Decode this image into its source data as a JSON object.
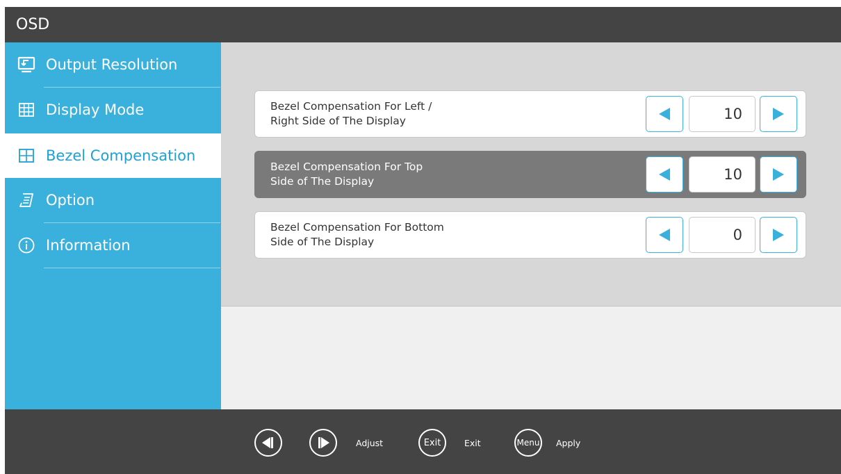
{
  "app": {
    "title": "OSD"
  },
  "sidebar": {
    "items": [
      {
        "label": "Output Resolution",
        "icon": "output-resolution-icon"
      },
      {
        "label": "Display Mode",
        "icon": "grid-icon"
      },
      {
        "label": "Bezel Compensation",
        "icon": "quad-grid-icon",
        "active": true
      },
      {
        "label": "Option",
        "icon": "document-icon"
      },
      {
        "label": "Information",
        "icon": "info-icon"
      }
    ]
  },
  "settings": [
    {
      "line1": "Bezel Compensation For Left /",
      "line2": "Right Side of The Display",
      "value": "10"
    },
    {
      "line1": "Bezel Compensation For Top",
      "line2": "Side of The Display",
      "value": "10",
      "selected": true
    },
    {
      "line1": "Bezel Compensation For Bottom",
      "line2": "Side of The Display",
      "value": "0"
    }
  ],
  "footer": {
    "adjust_label": "Adjust",
    "exit_button": "Exit",
    "exit_label": "Exit",
    "menu_button": "Menu",
    "apply_label": "Apply"
  },
  "colors": {
    "accent": "#3ab0dd",
    "dark_bar": "#444444",
    "selected_row": "#7a7a7a",
    "panel": "#d7d7d7"
  }
}
